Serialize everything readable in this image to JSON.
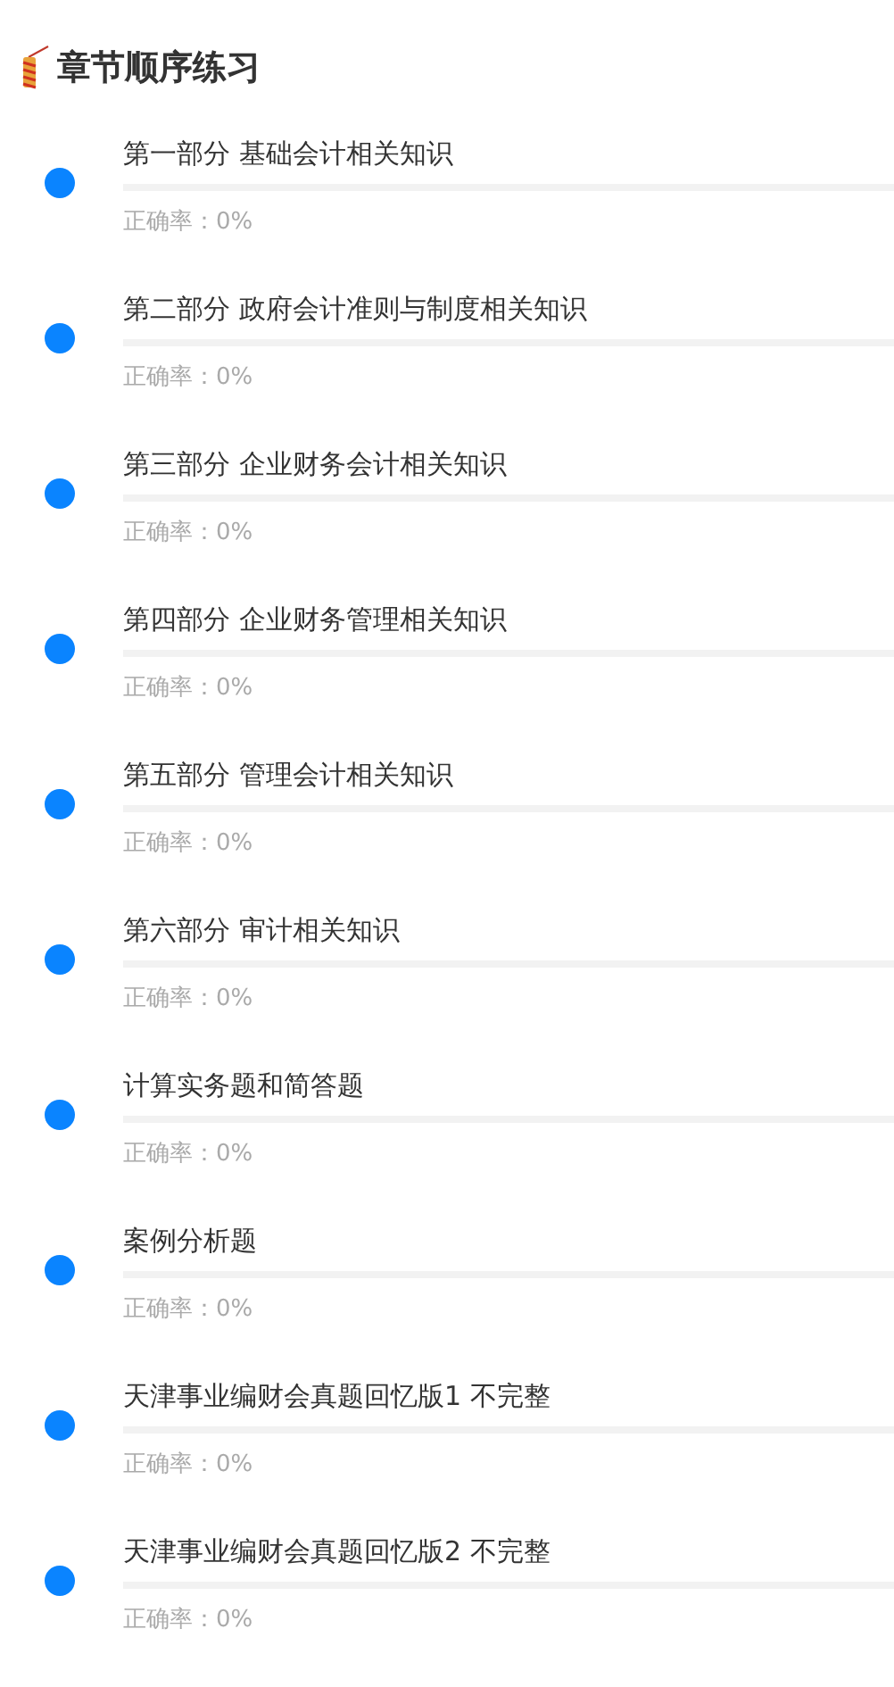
{
  "header": {
    "title": "章节顺序练习"
  },
  "chapters": [
    {
      "title": "第一部分 基础会计相关知识",
      "accuracy": "正确率：0%"
    },
    {
      "title": "第二部分 政府会计准则与制度相关知识",
      "accuracy": "正确率：0%"
    },
    {
      "title": "第三部分 企业财务会计相关知识",
      "accuracy": "正确率：0%"
    },
    {
      "title": "第四部分 企业财务管理相关知识",
      "accuracy": "正确率：0%"
    },
    {
      "title": "第五部分 管理会计相关知识",
      "accuracy": "正确率：0%"
    },
    {
      "title": "第六部分 审计相关知识",
      "accuracy": "正确率：0%"
    },
    {
      "title": "计算实务题和简答题",
      "accuracy": "正确率：0%"
    },
    {
      "title": "案例分析题",
      "accuracy": "正确率：0%"
    },
    {
      "title": "天津事业编财会真题回忆版1 不完整",
      "accuracy": "正确率：0%"
    },
    {
      "title": "天津事业编财会真题回忆版2 不完整",
      "accuracy": "正确率：0%"
    }
  ]
}
